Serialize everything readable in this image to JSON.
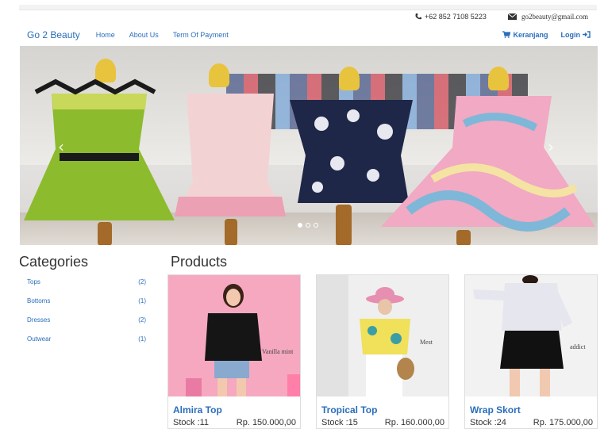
{
  "contact": {
    "phone": "+62 852 7108 5223",
    "email": "go2beauty@gmail.com",
    "phone_icon": "phone-icon",
    "email_icon": "envelope-icon"
  },
  "navbar": {
    "brand": "Go 2 Beauty",
    "links": [
      "Home",
      "About Us",
      "Term Of Payment"
    ],
    "cart_label": "Keranjang",
    "login_label": "Login",
    "accent_color": "#2a6ebb"
  },
  "carousel": {
    "slide_count": 3,
    "active_slide": 1
  },
  "categories": {
    "heading": "Categories",
    "items": [
      {
        "name": "Tops",
        "count": "(2)"
      },
      {
        "name": "Bottoms",
        "count": "(1)"
      },
      {
        "name": "Dresses",
        "count": "(2)"
      },
      {
        "name": "Outwear",
        "count": "(1)"
      }
    ]
  },
  "products": {
    "heading": "Products",
    "items": [
      {
        "name": "Almira Top",
        "stock": "Stock :11",
        "price": "Rp. 150.000,00",
        "watermark": "Vanilla mint"
      },
      {
        "name": "Tropical Top",
        "stock": "Stock :15",
        "price": "Rp. 160.000,00",
        "watermark": "Mest"
      },
      {
        "name": "Wrap Skort",
        "stock": "Stock :24",
        "price": "Rp. 175.000,00",
        "watermark": "addict"
      }
    ]
  }
}
